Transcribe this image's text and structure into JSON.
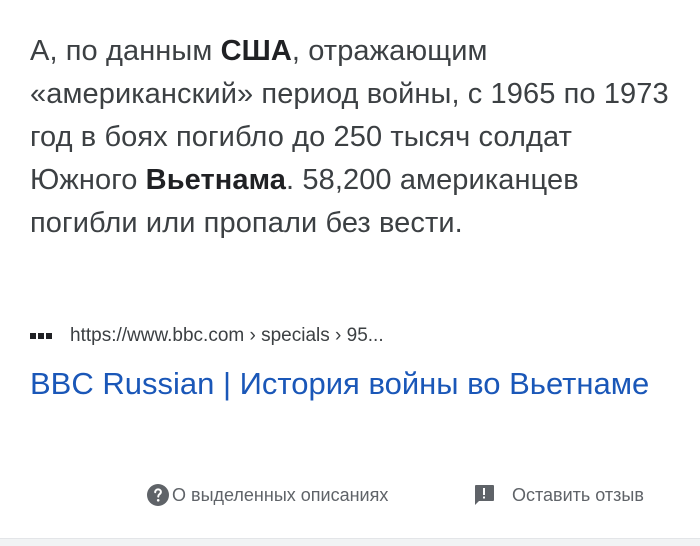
{
  "snippet": {
    "p1": "А, по данным ",
    "b1": "США",
    "p2": ", отражающим «американский» период войны, с 1965 по 1973 год в боях погибло до 250 тысяч солдат Южного ",
    "b2": "Вьетнама",
    "p3": ". 58,200 американцев погибли или пропали без вести."
  },
  "source": {
    "url": "https://www.bbc.com › specials › 95..."
  },
  "result": {
    "title": "BBC Russian | История войны во Вьетнаме"
  },
  "footer": {
    "about_label": "О выделенных описаниях",
    "feedback_label": "Оставить отзыв"
  },
  "icons": {
    "help": "help-circle-icon",
    "feedback": "feedback-icon",
    "favicon": "site-favicon-icon"
  },
  "colors": {
    "link": "#1a57b8",
    "text": "#3c4043",
    "muted": "#5f6368"
  }
}
